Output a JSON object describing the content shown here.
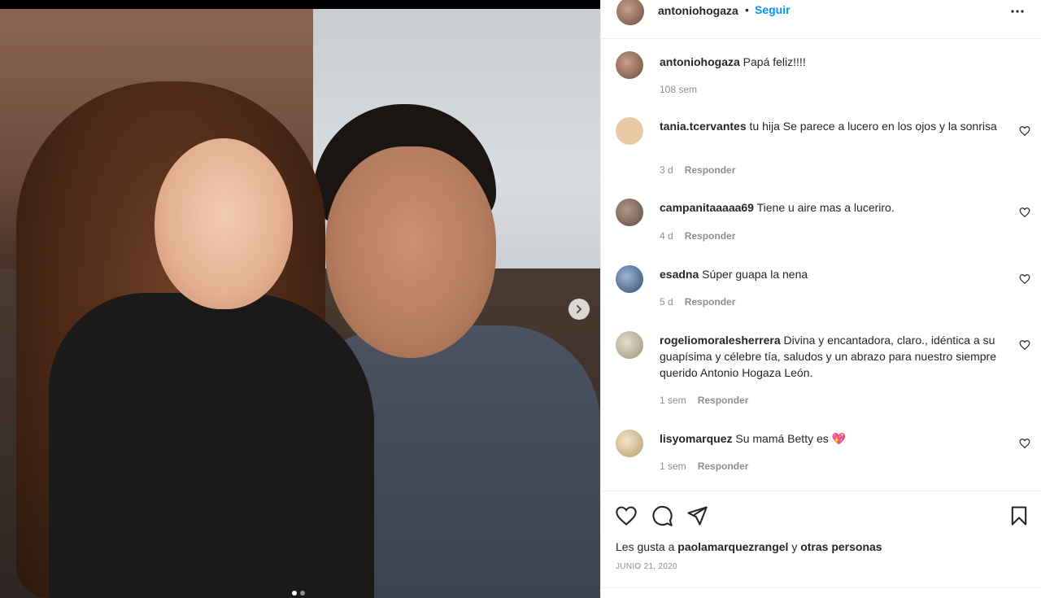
{
  "post": {
    "author": "antoniohogaza",
    "separator": "•",
    "follow_label": "Seguir",
    "caption_text": "Papá feliz!!!!",
    "caption_time": "108 sem"
  },
  "comments": [
    {
      "user": "tania.tcervantes",
      "text": "tu hija Se parece a lucero en los ojos y la sonrisa",
      "time": "3 d",
      "reply": "Responder",
      "avatar_color": "#e7c9a5"
    },
    {
      "user": "campanitaaaaa69",
      "text": "Tiene u aire mas a luceriro.",
      "time": "4 d",
      "reply": "Responder",
      "avatar_color": "#8a6f60"
    },
    {
      "user": "esadna",
      "text": "Súper guapa la nena",
      "time": "5 d",
      "reply": "Responder",
      "avatar_color": "#3f5f8a"
    },
    {
      "user": "rogeliomoralesherrera",
      "text": "Divina y encantadora, claro., idéntica a su guapísima y célebre tía, saludos y un abrazo para nuestro siempre querido Antonio Hogaza León.",
      "time": "1 sem",
      "reply": "Responder",
      "avatar_color": "#c9c3ad"
    },
    {
      "user": "lisyomarquez",
      "text": "Su mamá Betty es 💖",
      "time": "1 sem",
      "reply": "Responder",
      "avatar_color": "#e9d7b5"
    }
  ],
  "likes": {
    "prefix": "Les gusta a",
    "user": "paolamarquezrangel",
    "conj": "y",
    "others": "otras personas"
  },
  "date": "JUNIO 21, 2020",
  "icons": [
    "more-icon",
    "heart-icon",
    "comment-icon",
    "share-icon",
    "bookmark-icon",
    "chevron-right-icon"
  ],
  "colors": {
    "link": "#0095f6",
    "muted": "#8e8e8e",
    "text": "#262626"
  }
}
